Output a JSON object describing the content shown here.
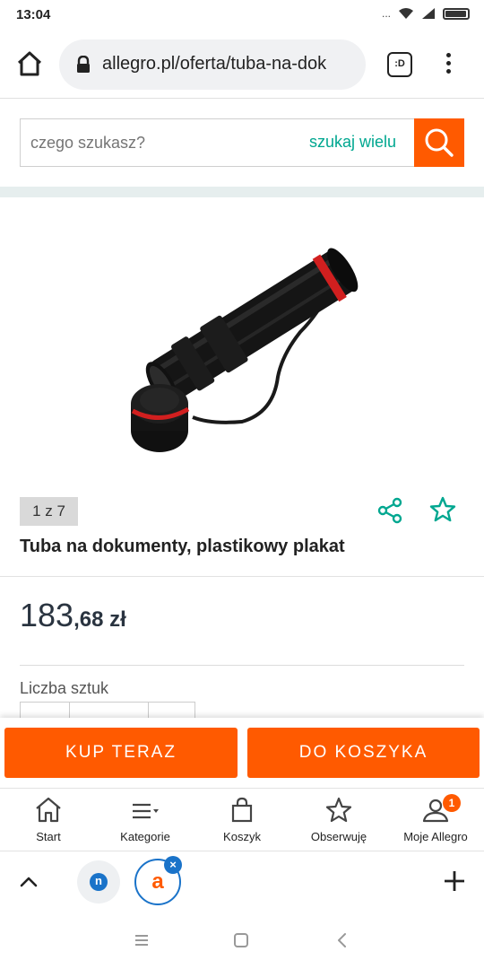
{
  "status": {
    "time": "13:04",
    "dots": "..."
  },
  "browser": {
    "url": "allegro.pl/oferta/tuba-na-dok",
    "tab_switch_label": ":D"
  },
  "search": {
    "placeholder": "czego szukasz?",
    "many_label": "szukaj wielu"
  },
  "product": {
    "image_counter": "1 z 7",
    "title": "Tuba na dokumenty, plastikowy plakat",
    "price_main": "183",
    "price_rest": ",68 zł",
    "quantity_label": "Liczba sztuk"
  },
  "actions": {
    "buy_now": "KUP TERAZ",
    "add_to_cart": "DO KOSZYKA"
  },
  "bottom_nav": {
    "items": [
      {
        "label": "Start",
        "icon": "home-icon"
      },
      {
        "label": "Kategorie",
        "icon": "menu-icon"
      },
      {
        "label": "Koszyk",
        "icon": "bag-icon"
      },
      {
        "label": "Obserwuję",
        "icon": "star-icon"
      },
      {
        "label": "Moje Allegro",
        "icon": "user-icon",
        "badge": "1"
      }
    ]
  },
  "tabs": {
    "tab1_letter": "n",
    "tab2_letter": "a",
    "close_symbol": "×"
  },
  "colors": {
    "accent": "#ff5a00",
    "teal": "#00a790",
    "tab_blue": "#1a73c9"
  }
}
